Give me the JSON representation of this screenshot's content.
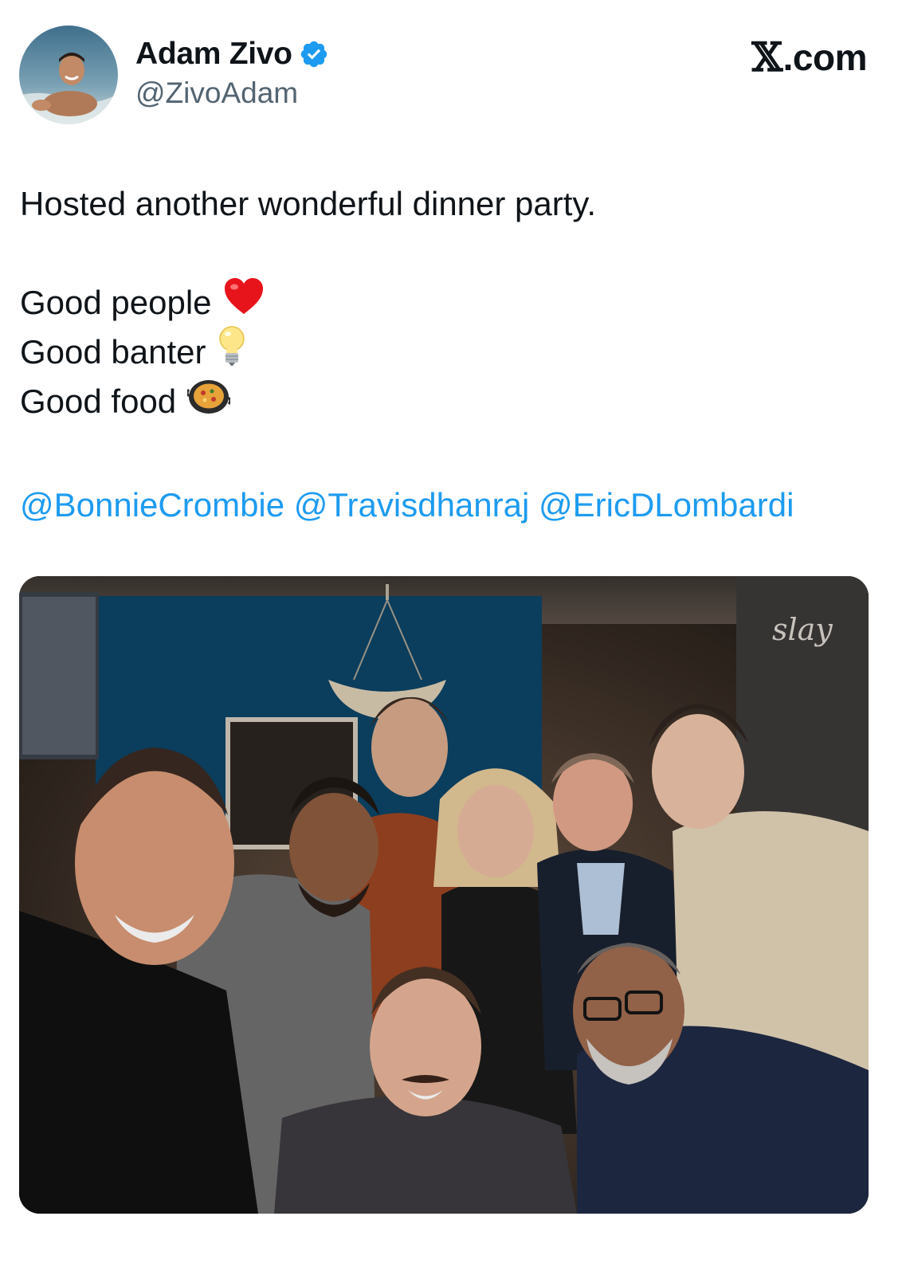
{
  "brand": {
    "label": ".com",
    "x_glyph": "𝕏"
  },
  "author": {
    "display_name": "Adam Zivo",
    "handle": "@ZivoAdam",
    "verified": true,
    "avatar_icon": "profile-photo"
  },
  "tweet": {
    "line1": "Hosted another wonderful dinner party.",
    "items": [
      {
        "text": "Good people",
        "icon": "red-heart-emoji"
      },
      {
        "text": "Good banter",
        "icon": "light-bulb-emoji"
      },
      {
        "text": "Good food",
        "icon": "paella-pan-emoji"
      }
    ],
    "mentions": [
      "@BonnieCrombie",
      "@Travisdhanraj",
      "@EricDLombardi"
    ]
  },
  "colors": {
    "mention": "#1d9bf0",
    "verified": "#1d9bf0",
    "text": "#0f1419",
    "secondary": "#536471"
  },
  "media": {
    "type": "group-photo",
    "wall_sign": "slay"
  }
}
